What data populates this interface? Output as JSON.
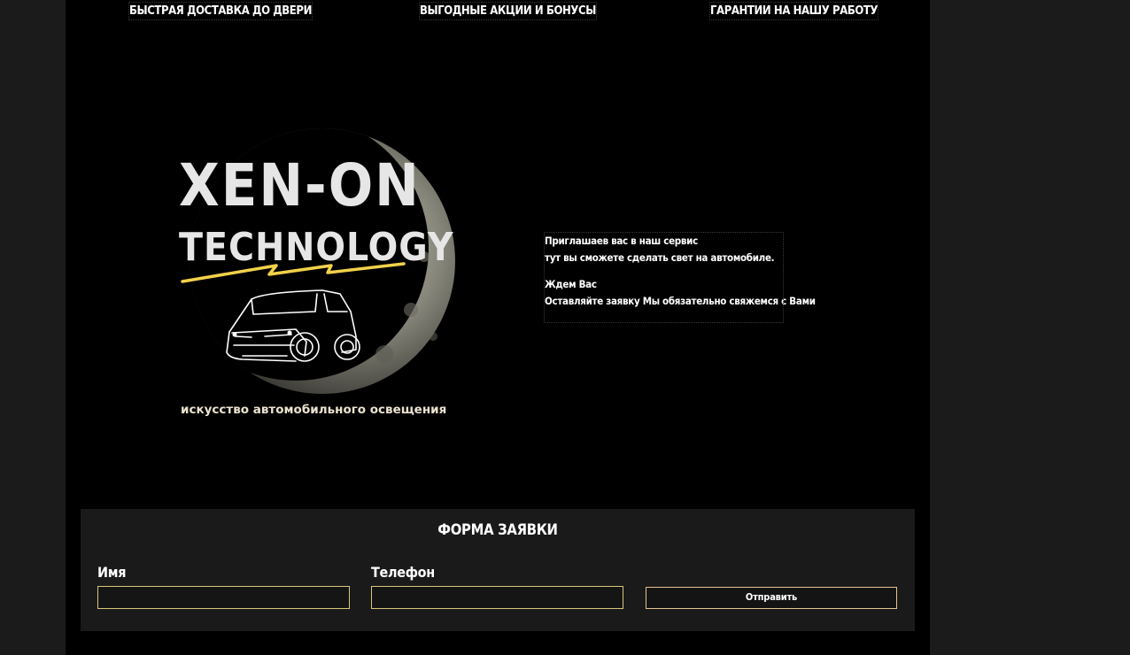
{
  "topbar": {
    "items": [
      "БЫСТРАЯ ДОСТАВКА ДО ДВЕРИ",
      "ВЫГОДНЫЕ АКЦИИ И БОНУСЫ",
      "ГАРАНТИИ НА НАШУ РАБОТУ"
    ]
  },
  "logo": {
    "line1": "XEN-ON",
    "line2": "TECHNOLOGY",
    "tagline": "искусство автомобильного освещения"
  },
  "intro": {
    "line1": "Приглашаев вас в наш сервис",
    "line2": "тут вы сможете сделать свет на автомобиле.",
    "line3": "Ждем Вас",
    "line4": "Оставляйте заявку Мы обязательно свяжемся с Вами"
  },
  "form": {
    "title": "ФОРМА ЗАЯВКИ",
    "name_label": "Имя",
    "name_value": "",
    "phone_label": "Телефон",
    "phone_value": "",
    "submit_label": "Отправить"
  },
  "colors": {
    "page_bg": "#000000",
    "outer_bg": "#1b1b1b",
    "form_bg": "#1a1a1a",
    "input_border": "#d9c77a",
    "lightning": "#f2d14a"
  }
}
